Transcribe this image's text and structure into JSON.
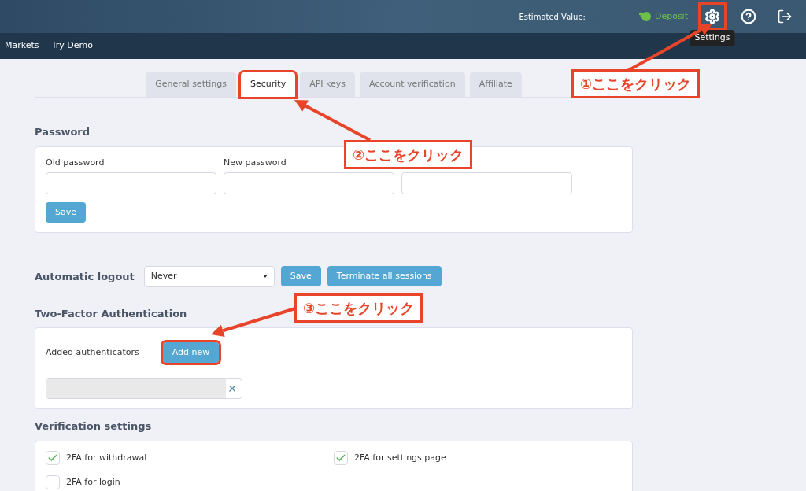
{
  "header": {
    "estimated_value_label": "Estimated Value:",
    "deposit": "Deposit",
    "icons": [
      {
        "kind": "settings",
        "highlighted": true,
        "tooltip": "Settings"
      },
      {
        "kind": "help",
        "highlighted": false
      },
      {
        "kind": "logout",
        "highlighted": false
      }
    ]
  },
  "nav": [
    "Markets",
    "Try Demo"
  ],
  "tabs": [
    {
      "label": "General settings",
      "selected": false,
      "highlighted": false
    },
    {
      "label": "Security",
      "selected": true,
      "highlighted": true
    },
    {
      "label": "API keys",
      "selected": false,
      "highlighted": false
    },
    {
      "label": "Account verification",
      "selected": false,
      "highlighted": false
    },
    {
      "label": "Affiliate",
      "selected": false,
      "highlighted": false
    }
  ],
  "password": {
    "title": "Password",
    "fields": [
      {
        "kind": "labeled",
        "label": "Old password"
      },
      {
        "kind": "labeled",
        "label": "New password"
      },
      {
        "kind": "unlabeled"
      }
    ],
    "save": "Save"
  },
  "logout": {
    "label": "Automatic logout",
    "value": "Never",
    "save": "Save",
    "terminate": "Terminate all sessions"
  },
  "two_factor": {
    "title": "Two-Factor Authentication",
    "label": "Added authenticators",
    "add": "Add new",
    "add_highlighted": true,
    "remove": "✕"
  },
  "verification": {
    "title": "Verification settings",
    "options": [
      {
        "label": "2FA for withdrawal",
        "checked": true
      },
      {
        "label": "2FA for settings page",
        "checked": true
      },
      {
        "label": "2FA for login",
        "checked": false
      }
    ]
  },
  "callouts": [
    "①ここをクリック",
    "②ここをクリック",
    "③ここをクリック"
  ]
}
